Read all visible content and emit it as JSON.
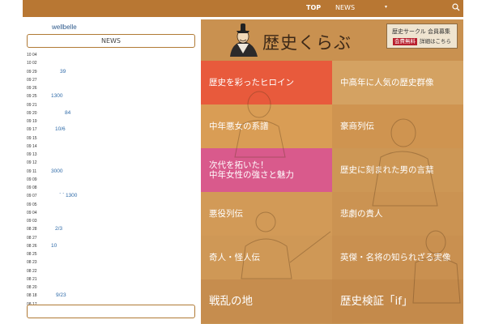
{
  "nav": {
    "top": "TOP",
    "news": "NEWS",
    "caret": "▾"
  },
  "site_name": "wellbelle",
  "news_heading": "NEWS",
  "news": [
    {
      "date": "10 04",
      "title": ""
    },
    {
      "date": "10 02",
      "title": ""
    },
    {
      "date": "09 29",
      "title": "39"
    },
    {
      "date": "09 27",
      "title": ""
    },
    {
      "date": "09 26",
      "title": ""
    },
    {
      "date": "09 25",
      "title": "1300"
    },
    {
      "date": "09 21",
      "title": ""
    },
    {
      "date": "09 20",
      "title": "84"
    },
    {
      "date": "09 19",
      "title": ""
    },
    {
      "date": "09 17",
      "title": "10/6"
    },
    {
      "date": "09 15",
      "title": ""
    },
    {
      "date": "09 14",
      "title": ""
    },
    {
      "date": "09 13",
      "title": ""
    },
    {
      "date": "09 12",
      "title": ""
    },
    {
      "date": "09 11",
      "title": "3000"
    },
    {
      "date": "09 09",
      "title": ""
    },
    {
      "date": "09 08",
      "title": ""
    },
    {
      "date": "09 07",
      "title": "ˊ ˊ 1300"
    },
    {
      "date": "09 05",
      "title": ""
    },
    {
      "date": "09 04",
      "title": ""
    },
    {
      "date": "09 03",
      "title": ""
    },
    {
      "date": "08 28",
      "title": "2/3"
    },
    {
      "date": "08 27",
      "title": ""
    },
    {
      "date": "08 26",
      "title": "10"
    },
    {
      "date": "08 25",
      "title": ""
    },
    {
      "date": "08 23",
      "title": ""
    },
    {
      "date": "08 22",
      "title": ""
    },
    {
      "date": "08 21",
      "title": ""
    },
    {
      "date": "08 20",
      "title": ""
    },
    {
      "date": "08 18",
      "title": "9/23"
    },
    {
      "date": "08 17",
      "title": ""
    }
  ],
  "logo": "歴史くらぶ",
  "recruit": {
    "line1": "歴史サークル 会員募集",
    "free": "会費無料",
    "more": "詳細はこちら"
  },
  "tiles": [
    {
      "label": "歴史を彩ったヒロイン",
      "color": "#e85a3c"
    },
    {
      "label": "中高年に人気の歴史群像",
      "color": "#d4a262"
    },
    {
      "label": "中年悪女の系譜",
      "color": "#d99d55"
    },
    {
      "label": "豪商列伝",
      "color": "#cf9450"
    },
    {
      "label": "次代を拓いた！\n中年女性の強さと魅力",
      "color": "#d95a8c"
    },
    {
      "label": "歴史に刻まれた男の言葉",
      "color": "#cd9755"
    },
    {
      "label": "悪役列伝",
      "color": "#d29a57"
    },
    {
      "label": "悲劇の貴人",
      "color": "#cb9352"
    },
    {
      "label": "奇人・怪人伝",
      "color": "#cf9856"
    },
    {
      "label": "英傑・名将の知られざる実像",
      "color": "#c99050"
    },
    {
      "label": "戦乱の地",
      "color": "#c68d4e"
    },
    {
      "label": "歴史検証「if」",
      "color": "#c48a4b"
    }
  ],
  "colors": {
    "bar": "#b87733",
    "border": "#b07a35",
    "link": "#2e6aa8"
  }
}
